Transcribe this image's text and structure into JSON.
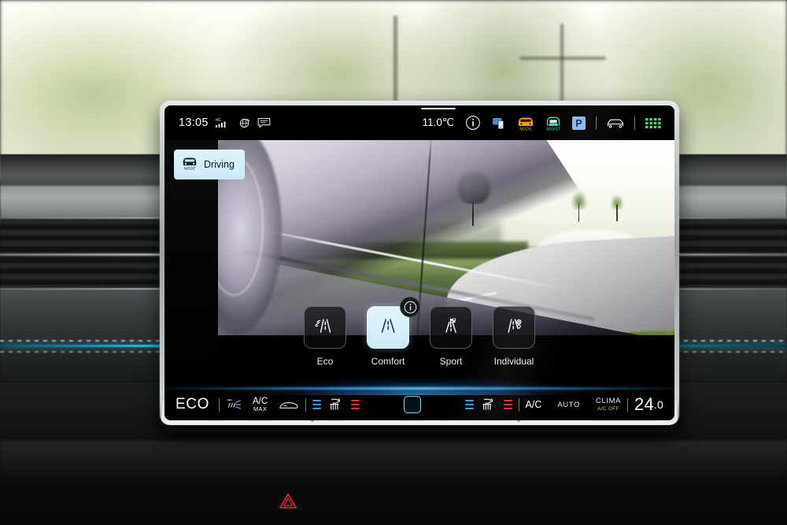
{
  "status_bar": {
    "time": "13:05",
    "network_label": "4G",
    "signal_icon": "signal-bars-icon",
    "globe_icon": "globe-icon",
    "message_icon": "message-bubble-icon",
    "outside_temperature": "11.0℃",
    "info_icon": "info-circle-icon",
    "phone_icon": "phone-projection-icon",
    "drive_mode_icon": "mode-car-icon",
    "drive_mode_label": "MODE",
    "assist_icon": "assist-car-icon",
    "assist_label": "ASSIST",
    "park_icon": "park-p-icon",
    "park_label": "P",
    "vehicle_icon": "vehicle-front-icon",
    "apps_icon": "apps-grid-icon"
  },
  "tab": {
    "icon": "mode-car-icon",
    "icon_label": "MODE",
    "label": "Driving"
  },
  "drive_modes": {
    "info_icon": "info-circle-icon",
    "items": [
      {
        "label": "Eco",
        "icon": "eco-leaf-road-icon",
        "selected": false
      },
      {
        "label": "Comfort",
        "icon": "comfort-road-icon",
        "selected": true
      },
      {
        "label": "Sport",
        "icon": "sport-flag-road-icon",
        "selected": false
      },
      {
        "label": "Individual",
        "icon": "individual-gear-road-icon",
        "selected": false
      }
    ]
  },
  "climate_bar": {
    "eco_label": "ECO",
    "rear_defrost_icon": "rear-defrost-icon",
    "ac_max_line1": "A/C",
    "ac_max_line2": "MAX",
    "front_defrost_icon": "front-defrost-icon",
    "left_seat_cool_icon": "seat-ventilation-bars-icon",
    "left_seat_icon": "heated-seat-icon",
    "left_seat_heat_icon": "seat-heating-bars-icon",
    "window_button_icon": "window-square-icon",
    "right_seat_cool_icon": "seat-ventilation-bars-icon",
    "right_seat_icon": "heated-seat-icon",
    "right_seat_heat_icon": "seat-heating-bars-icon",
    "ac_label": "A/C",
    "auto_label": "AUTO",
    "clima_label": "CLIMA",
    "clima_sub_label": "A/C OFF",
    "temperature": "24",
    "temperature_decimal": ".0"
  },
  "hardware": {
    "power_icon": "power-button-icon",
    "hazard_icon": "hazard-triangle-icon"
  },
  "colors": {
    "accent_blue": "#2e9ae8",
    "heat_red": "#e0303a",
    "active_tile": "#d8eef8",
    "warning_yellow": "#e8c21e",
    "assist_green": "#3fd6b0",
    "mode_orange": "#f2a216",
    "park_blue": "#8ab6f0",
    "apps_green": "#4fd07a"
  }
}
